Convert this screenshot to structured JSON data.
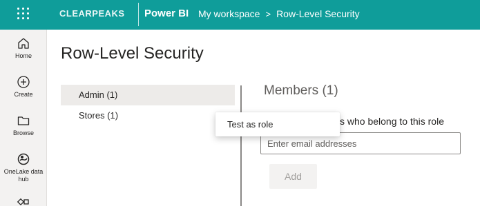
{
  "header": {
    "brand": "CLEARPEAKS",
    "product": "Power BI",
    "breadcrumbs": [
      "My workspace",
      "Row-Level Security"
    ],
    "separator": ">",
    "color": "#0f9d9a"
  },
  "rail": {
    "items": [
      {
        "label": "Home",
        "icon": "home-icon"
      },
      {
        "label": "Create",
        "icon": "plus-circle-icon"
      },
      {
        "label": "Browse",
        "icon": "folder-icon"
      },
      {
        "label": "OneLake data hub",
        "icon": "onelake-icon"
      },
      {
        "label": "",
        "icon": "apps-icon"
      }
    ]
  },
  "page": {
    "title": "Row-Level Security"
  },
  "roles": [
    {
      "label": "Admin (1)",
      "selected": true
    },
    {
      "label": "Stores (1)",
      "selected": false
    }
  ],
  "members": {
    "title": "Members (1)",
    "description": "s who belong to this role",
    "input_placeholder": "Enter email addresses",
    "add_label": "Add"
  },
  "context_menu": {
    "item": "Test as role"
  }
}
